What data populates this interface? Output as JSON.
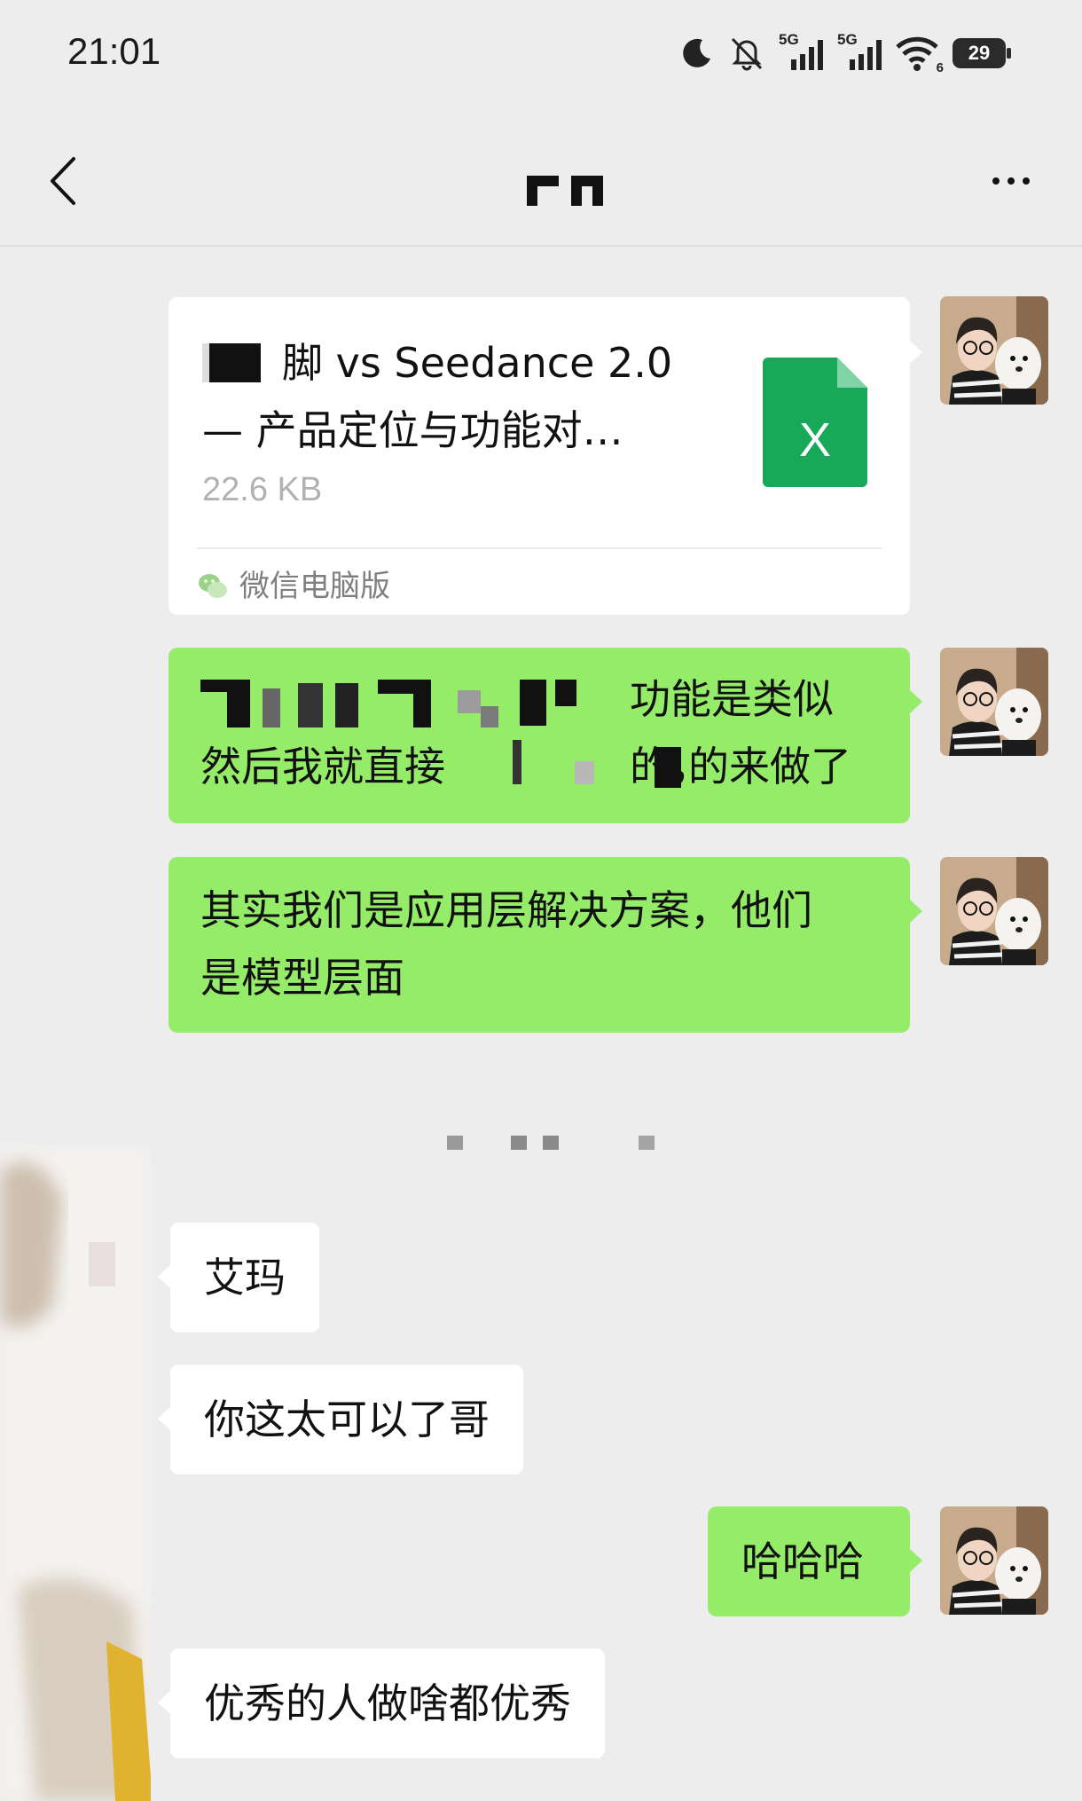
{
  "status_bar": {
    "time": "21:01",
    "signal_1_label": "5G",
    "signal_2_label": "5G",
    "wifi_badge": "6",
    "battery": "29"
  },
  "nav": {
    "back_icon": "chevron-left-icon",
    "more_icon": "more-dots-icon"
  },
  "file_message": {
    "name_line1": "脚 vs Seedance 2.0",
    "name_line2": "— 产品定位与功能对…",
    "size": "22.6 KB",
    "source": "微信电脑版",
    "icon_letter": "X",
    "icon_color": "#17a85a"
  },
  "messages": [
    {
      "side": "right",
      "line1": "功能是类似的，",
      "line2_prefix": "然后我就直接",
      "line2_suffix": "的来做了"
    },
    {
      "side": "right",
      "line1": "其实我们是应用层解决方案，他们",
      "line2": "是模型层面"
    },
    {
      "side": "left",
      "text": "艾玛"
    },
    {
      "side": "left",
      "text": "你这太可以了哥"
    },
    {
      "side": "right",
      "text": "哈哈哈"
    },
    {
      "side": "left",
      "text": "优秀的人做啥都优秀"
    }
  ],
  "colors": {
    "background": "#ededed",
    "self_bubble": "#95ec69",
    "other_bubble": "#ffffff"
  }
}
